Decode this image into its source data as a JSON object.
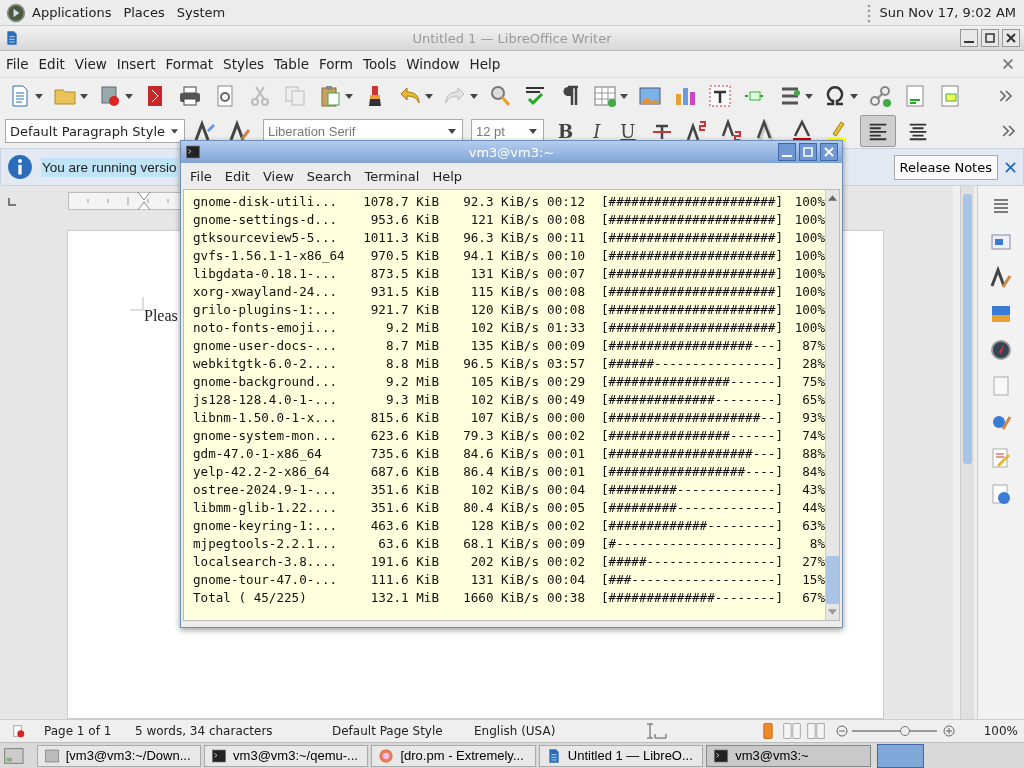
{
  "top_panel": {
    "menus": [
      "Applications",
      "Places",
      "System"
    ],
    "clock": "Sun Nov 17, 9:02 AM"
  },
  "writer": {
    "title": "Untitled 1 — LibreOffice Writer",
    "menu": [
      "File",
      "Edit",
      "View",
      "Insert",
      "Format",
      "Styles",
      "Table",
      "Form",
      "Tools",
      "Window",
      "Help"
    ],
    "paragraph_style": "Default Paragraph Style",
    "font_name": "Liberation Serif",
    "font_size": "12 pt",
    "format_letters": [
      "B",
      "I",
      "U"
    ],
    "align_buttons": [
      {
        "kind": "left",
        "selected": true
      },
      {
        "kind": "center",
        "selected": false
      }
    ],
    "infobar": {
      "message": "You are running versio",
      "button": "Release Notes"
    },
    "document_text": "Pleas",
    "status_bar": {
      "page": "Page 1 of 1",
      "words": "5 words, 34 characters",
      "page_style": "Default Page Style",
      "language": "English (USA)",
      "view_layouts": [
        {
          "kind": "single",
          "selected": true
        },
        {
          "kind": "multi",
          "selected": false
        },
        {
          "kind": "book",
          "selected": false
        }
      ],
      "zoom": {
        "level": 0.62
      },
      "zoom_percent": "100%"
    }
  },
  "terminal": {
    "title": "vm3@vm3:~",
    "menu": [
      "File",
      "Edit",
      "View",
      "Search",
      "Terminal",
      "Help"
    ],
    "rows": [
      {
        "name": "gnome-disk-utili...",
        "size": "1078.7 KiB",
        "rate": "92.3 KiB/s",
        "eta": "00:12",
        "bar": "[######################]",
        "percent": "100%"
      },
      {
        "name": "gnome-settings-d...",
        "size": "953.6 KiB",
        "rate": "121 KiB/s",
        "eta": "00:08",
        "bar": "[######################]",
        "percent": "100%"
      },
      {
        "name": "gtksourceview5-5...",
        "size": "1011.3 KiB",
        "rate": "96.3 KiB/s",
        "eta": "00:11",
        "bar": "[######################]",
        "percent": "100%"
      },
      {
        "name": "gvfs-1.56.1-1-x86_64",
        "size": "970.5 KiB",
        "rate": "94.1 KiB/s",
        "eta": "00:10",
        "bar": "[######################]",
        "percent": "100%"
      },
      {
        "name": "libgdata-0.18.1-...",
        "size": "873.5 KiB",
        "rate": "131 KiB/s",
        "eta": "00:07",
        "bar": "[######################]",
        "percent": "100%"
      },
      {
        "name": "xorg-xwayland-24...",
        "size": "931.5 KiB",
        "rate": "115 KiB/s",
        "eta": "00:08",
        "bar": "[######################]",
        "percent": "100%"
      },
      {
        "name": "grilo-plugins-1:...",
        "size": "921.7 KiB",
        "rate": "120 KiB/s",
        "eta": "00:08",
        "bar": "[######################]",
        "percent": "100%"
      },
      {
        "name": "noto-fonts-emoji...",
        "size": "9.2 MiB",
        "rate": "102 KiB/s",
        "eta": "01:33",
        "bar": "[######################]",
        "percent": "100%"
      },
      {
        "name": "gnome-user-docs-...",
        "size": "8.7 MiB",
        "rate": "135 KiB/s",
        "eta": "00:09",
        "bar": "[###################---]",
        "percent": "87%"
      },
      {
        "name": "webkitgtk-6.0-2....",
        "size": "8.8 MiB",
        "rate": "96.5 KiB/s",
        "eta": "03:57",
        "bar": "[######----------------]",
        "percent": "28%"
      },
      {
        "name": "gnome-background...",
        "size": "9.2 MiB",
        "rate": "105 KiB/s",
        "eta": "00:29",
        "bar": "[################------]",
        "percent": "75%"
      },
      {
        "name": "js128-128.4.0-1-...",
        "size": "9.3 MiB",
        "rate": "102 KiB/s",
        "eta": "00:49",
        "bar": "[##############--------]",
        "percent": "65%"
      },
      {
        "name": "libnm-1.50.0-1-x...",
        "size": "815.6 KiB",
        "rate": "107 KiB/s",
        "eta": "00:00",
        "bar": "[####################--]",
        "percent": "93%"
      },
      {
        "name": "gnome-system-mon...",
        "size": "623.6 KiB",
        "rate": "79.3 KiB/s",
        "eta": "00:02",
        "bar": "[################------]",
        "percent": "74%"
      },
      {
        "name": "gdm-47.0-1-x86_64",
        "size": "735.6 KiB",
        "rate": "84.6 KiB/s",
        "eta": "00:01",
        "bar": "[###################---]",
        "percent": "88%"
      },
      {
        "name": "yelp-42.2-2-x86_64",
        "size": "687.6 KiB",
        "rate": "86.4 KiB/s",
        "eta": "00:01",
        "bar": "[##################----]",
        "percent": "84%"
      },
      {
        "name": "ostree-2024.9-1-...",
        "size": "351.6 KiB",
        "rate": "102 KiB/s",
        "eta": "00:04",
        "bar": "[#########-------------]",
        "percent": "43%"
      },
      {
        "name": "libmm-glib-1.22....",
        "size": "351.6 KiB",
        "rate": "80.4 KiB/s",
        "eta": "00:05",
        "bar": "[#########-------------]",
        "percent": "44%"
      },
      {
        "name": "gnome-keyring-1:...",
        "size": "463.6 KiB",
        "rate": "128 KiB/s",
        "eta": "00:02",
        "bar": "[#############---------]",
        "percent": "63%"
      },
      {
        "name": "mjpegtools-2.2.1...",
        "size": "63.6 KiB",
        "rate": "68.1 KiB/s",
        "eta": "00:09",
        "bar": "[#---------------------]",
        "percent": "8%"
      },
      {
        "name": "localsearch-3.8....",
        "size": "191.6 KiB",
        "rate": "202 KiB/s",
        "eta": "00:02",
        "bar": "[#####-----------------]",
        "percent": "27%"
      },
      {
        "name": "gnome-tour-47.0-...",
        "size": "111.6 KiB",
        "rate": "131 KiB/s",
        "eta": "00:04",
        "bar": "[###-------------------]",
        "percent": "15%"
      },
      {
        "name": "Total ( 45/225)",
        "size": "132.1 MiB",
        "rate": "1660 KiB/s",
        "eta": "00:38",
        "bar": "[##############--------]",
        "percent": "67%"
      }
    ]
  },
  "taskbar": {
    "tasks": [
      {
        "label": "[vm3@vm3:~/Down...",
        "kind": "window",
        "selected": false
      },
      {
        "label": "vm3@vm3:~/qemu-...",
        "kind": "terminal",
        "selected": false
      },
      {
        "label": "[dro.pm - Extremely...",
        "kind": "browser",
        "selected": false
      },
      {
        "label": "Untitled 1 — LibreO...",
        "kind": "writer",
        "selected": false
      },
      {
        "label": "vm3@vm3:~",
        "kind": "terminal",
        "selected": true
      }
    ]
  }
}
